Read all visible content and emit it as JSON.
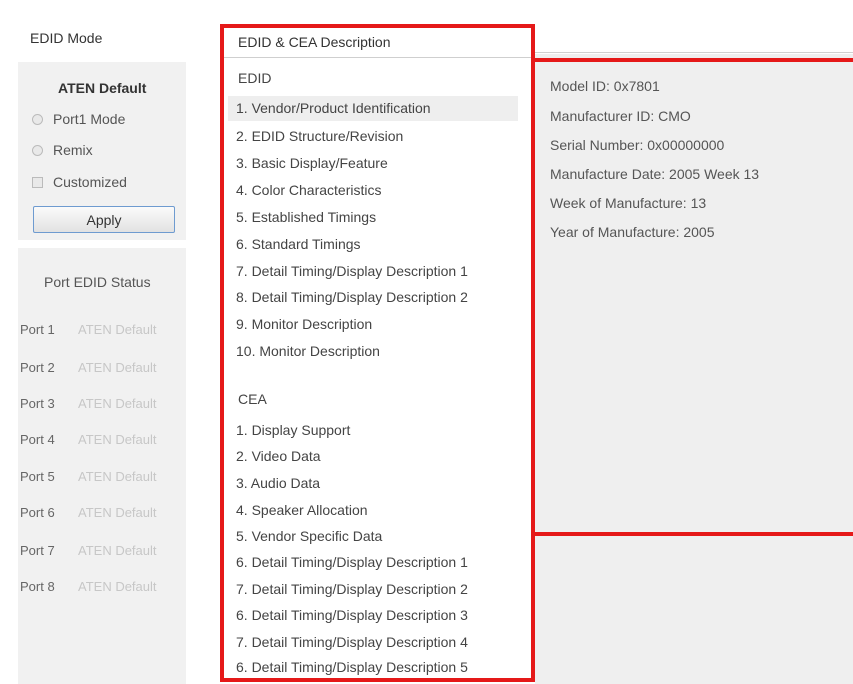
{
  "left": {
    "mode_title": "EDID Mode",
    "default_title": "ATEN Default",
    "options": [
      "Port1 Mode",
      "Remix",
      "Customized"
    ],
    "apply_label": "Apply",
    "status_title": "Port EDID Status",
    "ports": [
      {
        "name": "Port 1",
        "status": "ATEN Default"
      },
      {
        "name": "Port 2",
        "status": "ATEN Default"
      },
      {
        "name": "Port 3",
        "status": "ATEN Default"
      },
      {
        "name": "Port 4",
        "status": "ATEN Default"
      },
      {
        "name": "Port 5",
        "status": "ATEN Default"
      },
      {
        "name": "Port 6",
        "status": "ATEN Default"
      },
      {
        "name": "Port 7",
        "status": "ATEN Default"
      },
      {
        "name": "Port 8",
        "status": "ATEN Default"
      }
    ]
  },
  "middle": {
    "header": "EDID & CEA Description",
    "edid_title": "EDID",
    "edid_items": [
      "1. Vendor/Product Identification",
      "2. EDID Structure/Revision",
      "3. Basic Display/Feature",
      "4. Color Characteristics",
      "5. Established Timings",
      "6. Standard Timings",
      "7. Detail Timing/Display Description 1",
      "8. Detail Timing/Display Description 2",
      "9. Monitor Description",
      "10. Monitor Description"
    ],
    "cea_title": "CEA",
    "cea_items": [
      "1. Display Support",
      "2. Video Data",
      "3. Audio Data",
      "4. Speaker Allocation",
      "5. Vendor Specific Data",
      "6. Detail Timing/Display Description 1",
      "7. Detail Timing/Display Description 2",
      "6. Detail Timing/Display Description 3",
      "7. Detail Timing/Display Description 4",
      "6. Detail Timing/Display Description 5"
    ]
  },
  "right": {
    "details": [
      "Model ID: 0x7801",
      "Manufacturer ID: CMO",
      "Serial Number: 0x00000000",
      "Manufacture Date: 2005 Week 13",
      "Week of Manufacture: 13",
      "Year of Manufacture: 2005"
    ]
  },
  "colors": {
    "highlight": "#e51919",
    "button_border": "#6e9bd0"
  }
}
